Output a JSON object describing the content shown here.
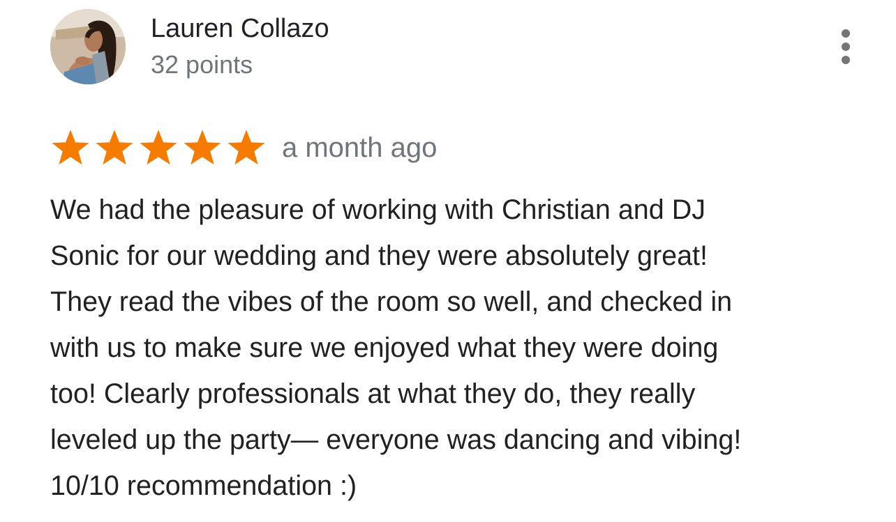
{
  "reviewer": {
    "name": "Lauren Collazo",
    "points": "32 points",
    "avatar_icon": "user-photo-avatar"
  },
  "menu": {
    "icon": "more-vert-icon"
  },
  "rating": {
    "stars": 5,
    "max_stars": 5,
    "star_color": "#f57c00",
    "icon": "star-icon"
  },
  "review": {
    "date": "a month ago",
    "lines": [
      "We had the pleasure of working with Christian and DJ",
      "Sonic for our wedding and they were absolutely great!",
      "They read the vibes of the room so well, and checked in",
      "with us to make sure we enjoyed what they were doing",
      "too! Clearly professionals at what they do, they really",
      "leveled up the party— everyone was dancing and vibing!",
      "10/10 recommendation :)"
    ]
  },
  "colors": {
    "name_text": "#202124",
    "secondary_text": "#70757a",
    "body_text": "#212121",
    "menu_dots": "#757575"
  }
}
